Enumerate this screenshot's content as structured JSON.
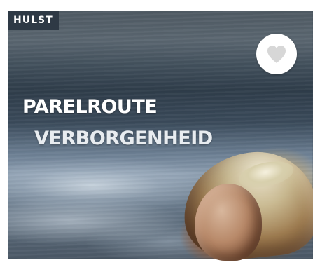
{
  "card": {
    "location_tag": "HULST",
    "title": "PARELROUTE",
    "subtitle": "VERBORGENHEID",
    "favorite_icon": "heart-icon"
  },
  "colors": {
    "tag_background": "#2e3945",
    "title_text": "#ffffff",
    "favorite_button": "#ffffff",
    "heart_fill": "#d7d7d7"
  }
}
